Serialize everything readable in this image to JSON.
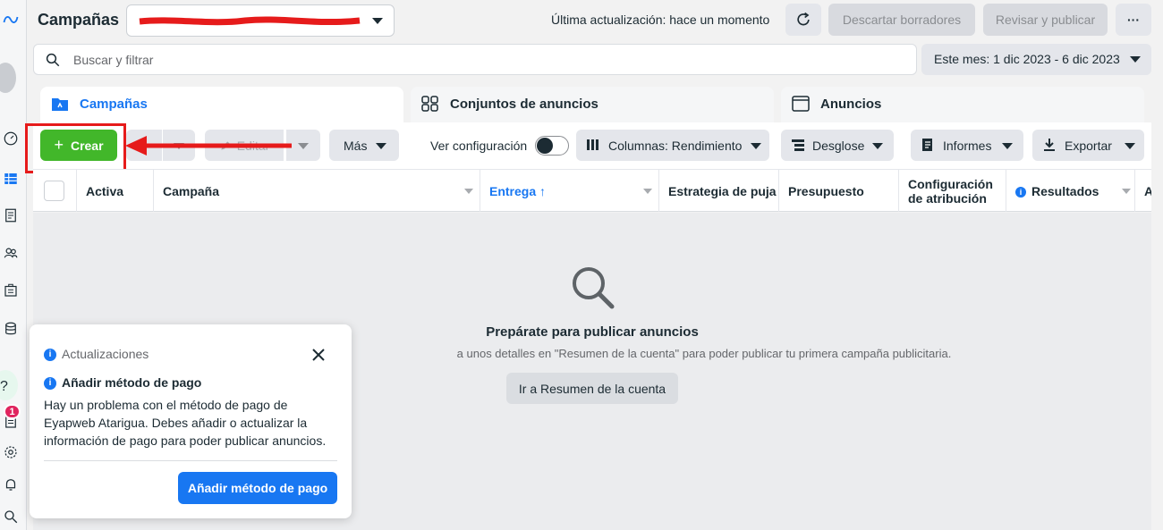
{
  "header": {
    "title": "Campañas",
    "account_select_value": "",
    "last_update": "Última actualización: hace un momento",
    "discard_label": "Descartar borradores",
    "review_label": "Revisar y publicar",
    "more_label": "···"
  },
  "search": {
    "placeholder": "Buscar y filtrar"
  },
  "date_range": {
    "label": "Este mes: 1 dic 2023 - 6 dic 2023"
  },
  "tabs": [
    {
      "label": "Campañas",
      "active": true
    },
    {
      "label": "Conjuntos de anuncios",
      "active": false
    },
    {
      "label": "Anuncios",
      "active": false
    }
  ],
  "toolbar": {
    "create_label": "Crear",
    "edit_label": "Editar",
    "more_label": "Más",
    "config_label": "Ver configuración",
    "columns_label": "Columnas: Rendimiento",
    "breakdown_label": "Desglose",
    "reports_label": "Informes",
    "export_label": "Exportar"
  },
  "table": {
    "columns": [
      {
        "label": "Activa"
      },
      {
        "label": "Campaña"
      },
      {
        "label": "Entrega ↑"
      },
      {
        "label": "Estrategia de puja"
      },
      {
        "label": "Presupuesto"
      },
      {
        "label": "Configuración de atribución"
      },
      {
        "label": "Resultados"
      },
      {
        "label": "A"
      }
    ]
  },
  "empty_state": {
    "title": "Prepárate para publicar anuncios",
    "description": "a unos detalles en \"Resumen de la cuenta\" para poder publicar tu primera campaña publicitaria.",
    "button_label": "Ir a Resumen de la cuenta"
  },
  "notice": {
    "header": "Actualizaciones",
    "title": "Añadir método de pago",
    "body": "Hay un problema con el método de pago de Eyapweb Atarigua. Debes añadir o actualizar la información de pago para poder publicar anuncios.",
    "cta_label": "Añadir método de pago"
  },
  "sidebar": {
    "notification_count": "1"
  },
  "colors": {
    "accent": "#1877f2",
    "create_green": "#42b72a",
    "highlight_red": "#e61b1b"
  },
  "icons": [
    "meta-logo-icon",
    "avatar",
    "dashboard-icon",
    "campaigns-icon",
    "reports-icon",
    "audiences-icon",
    "business-icon",
    "billing-icon",
    "help-icon",
    "notifications-icon",
    "settings-icon",
    "bell-icon",
    "search-icon"
  ]
}
